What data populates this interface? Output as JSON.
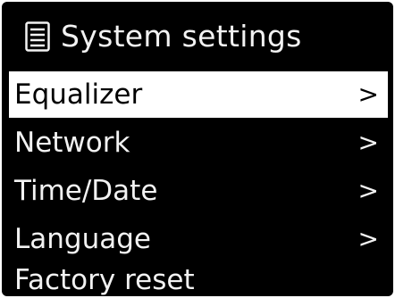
{
  "header": {
    "icon": "list-icon",
    "title": "System settings"
  },
  "menu": {
    "items": [
      {
        "label": "Equalizer",
        "chevron": ">",
        "selected": true
      },
      {
        "label": "Network",
        "chevron": ">",
        "selected": false
      },
      {
        "label": "Time/Date",
        "chevron": ">",
        "selected": false
      },
      {
        "label": "Language",
        "chevron": ">",
        "selected": false
      },
      {
        "label": "Factory reset",
        "chevron": "",
        "selected": false
      }
    ]
  },
  "colors": {
    "background": "#000000",
    "text": "#f2f2f2",
    "highlight_bg": "#ffffff",
    "highlight_text": "#000000"
  }
}
